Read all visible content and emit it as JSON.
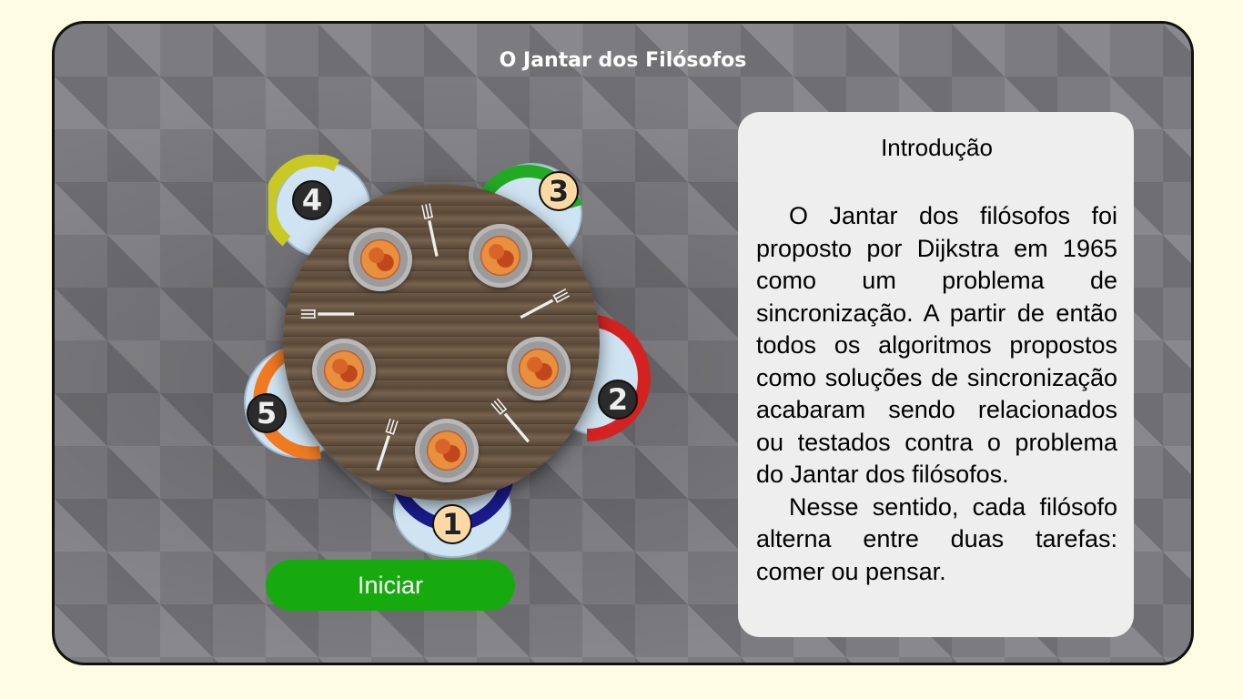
{
  "header": {
    "title": "O Jantar dos Filósofos"
  },
  "philosophers": [
    {
      "number": "1",
      "color": "#1a1a8c"
    },
    {
      "number": "2",
      "color": "#d42222"
    },
    {
      "number": "3",
      "color": "#22aa22"
    },
    {
      "number": "4",
      "color": "#c9c925"
    },
    {
      "number": "5",
      "color": "#f07a20"
    }
  ],
  "controls": {
    "start_label": "Iniciar",
    "start_color": "#17aa0e"
  },
  "intro": {
    "title": "Introdução",
    "paragraph1": "O Jantar dos filósofos foi proposto por Dijkstra em 1965 como um problema de sincronização. A partir de então todos os algoritmos propostos como soluções de sincronização acabaram sendo relacionados ou testados contra o problema do Jantar dos filósofos.",
    "paragraph2": "Nesse sentido, cada filósofo alterna entre duas tarefas: comer ou pensar."
  },
  "icons": [
    "plate-icon",
    "fork-icon",
    "chair-icon"
  ]
}
